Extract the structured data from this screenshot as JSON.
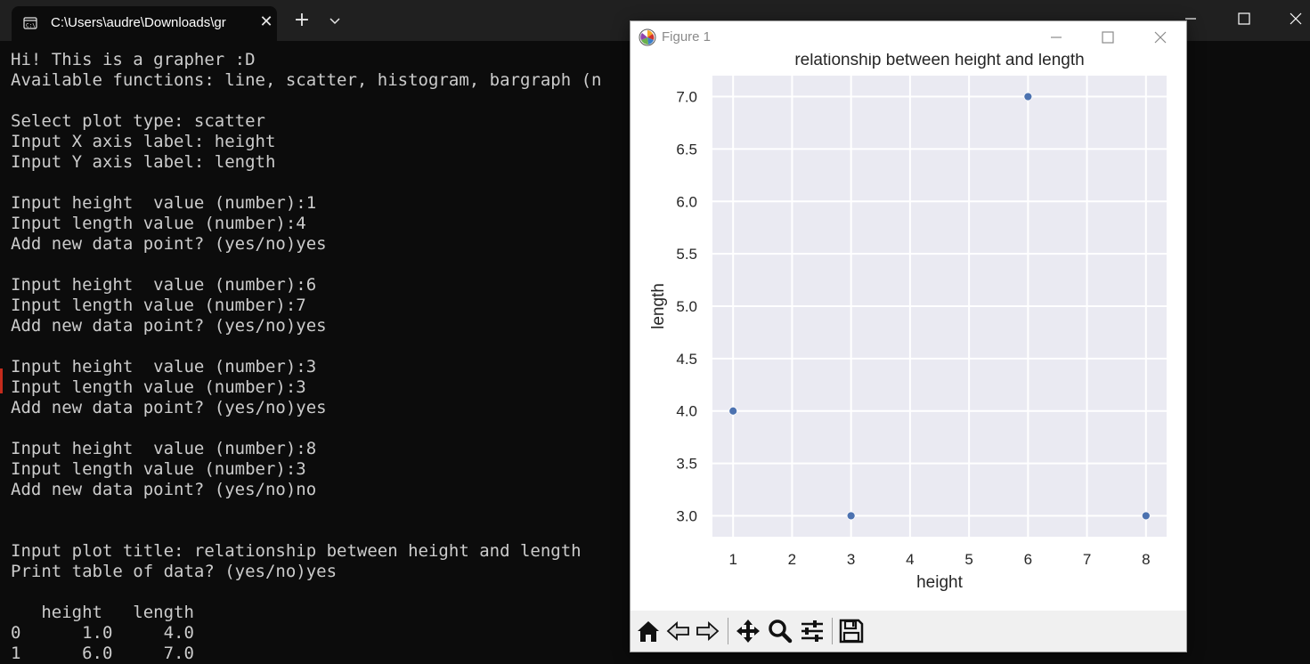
{
  "terminal": {
    "tab_title": "C:\\Users\\audre\\Downloads\\gr",
    "lines": [
      "Hi! This is a grapher :D",
      "Available functions: line, scatter, histogram, bargraph (n",
      "",
      "Select plot type: scatter",
      "Input X axis label: height",
      "Input Y axis label: length",
      "",
      "Input height  value (number):1",
      "Input length value (number):4",
      "Add new data point? (yes/no)yes",
      "",
      "Input height  value (number):6",
      "Input length value (number):7",
      "Add new data point? (yes/no)yes",
      "",
      "Input height  value (number):3",
      "Input length value (number):3",
      "Add new data point? (yes/no)yes",
      "",
      "Input height  value (number):8",
      "Input length value (number):3",
      "Add new data point? (yes/no)no",
      "",
      "",
      "Input plot title: relationship between height and length",
      "Print table of data? (yes/no)yes",
      "",
      "   height   length",
      "0      1.0     4.0",
      "1      6.0     7.0"
    ]
  },
  "figure": {
    "window_title": "Figure 1",
    "toolbar_icons": [
      "home-icon",
      "back-icon",
      "forward-icon",
      "pan-icon",
      "zoom-icon",
      "configure-subplots-icon",
      "save-icon"
    ]
  },
  "chart_data": {
    "type": "scatter",
    "title": "relationship between height and length",
    "xlabel": "height",
    "ylabel": "length",
    "x": [
      1,
      6,
      3,
      8
    ],
    "y": [
      4,
      7,
      3,
      3
    ],
    "xlim": [
      0.65,
      8.35
    ],
    "ylim": [
      2.8,
      7.2
    ],
    "xticks": [
      "1",
      "2",
      "3",
      "4",
      "5",
      "6",
      "7",
      "8"
    ],
    "yticks": [
      "3.0",
      "3.5",
      "4.0",
      "4.5",
      "5.0",
      "5.5",
      "6.0",
      "6.5",
      "7.0"
    ],
    "grid": true,
    "colors": {
      "background": "#eaeaf2",
      "grid": "#ffffff",
      "marker": "#4c72b0"
    }
  }
}
